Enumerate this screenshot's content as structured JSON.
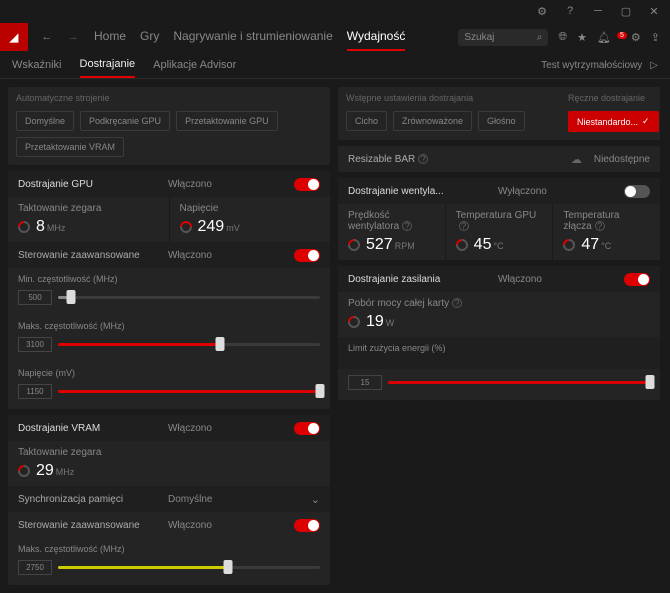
{
  "win": {
    "search_placeholder": "Szukaj",
    "notif_count": "5"
  },
  "mainnav": {
    "home": "Home",
    "games": "Gry",
    "stream": "Nagrywanie i strumieniowanie",
    "perf": "Wydajność"
  },
  "subnav": {
    "ind": "Wskaźniki",
    "tune": "Dostrajanie",
    "adv": "Aplikacje Advisor",
    "stress": "Test wytrzymałościowy"
  },
  "left": {
    "auto_head": "Automatyczne strojenie",
    "p1": "Domyślne",
    "p2": "Podkręcanie GPU",
    "p3": "Przetaktowanie GPU",
    "p4": "Przetaktowanie VRAM",
    "gpu_tune": "Dostrajanie GPU",
    "on": "Włączono",
    "clock": "Taktowanie zegara",
    "clock_v": "8",
    "clock_u": "MHz",
    "volt": "Napięcie",
    "volt_v": "249",
    "volt_u": "mV",
    "adv_ctrl": "Sterowanie zaawansowane",
    "min_f": "Min. częstotliwość (MHz)",
    "min_f_v": "500",
    "max_f": "Maks. częstotliwość (MHz)",
    "max_f_v": "3100",
    "napm": "Napięcie (mV)",
    "napm_v": "1150",
    "vram_tune": "Dostrajanie VRAM",
    "vclock": "Taktowanie zegara",
    "vclock_v": "29",
    "vclock_u": "MHz",
    "sync": "Synchronizacja pamięci",
    "sync_v": "Domyślne",
    "vmax": "Maks. częstotliwość (MHz)",
    "vmax_v": "2750"
  },
  "right": {
    "preset_head": "Wstępne ustawienia dostrajania",
    "manual_head": "Ręczne dostrajanie",
    "q1": "Cicho",
    "q2": "Zrównoważone",
    "q3": "Głośno",
    "custom": "Niestandardo...",
    "rbar": "Resizable BAR",
    "rbar_v": "Niedostępne",
    "fan_tune": "Dostrajanie wentyla...",
    "off": "Wyłączono",
    "fanspeed": "Prędkość wentylatora",
    "fan_v": "527",
    "fan_u": "RPM",
    "tgpu": "Temperatura GPU",
    "tgpu_v": "45",
    "tc": "°C",
    "tjun": "Temperatura złącza",
    "tjun_v": "47",
    "pwr_tune": "Dostrajanie zasilania",
    "on": "Włączono",
    "bpow": "Pobór mocy całej karty",
    "bpow_v": "19",
    "bpow_u": "W",
    "plimit": "Limit zużycia energii (%)",
    "plimit_v": "15"
  }
}
